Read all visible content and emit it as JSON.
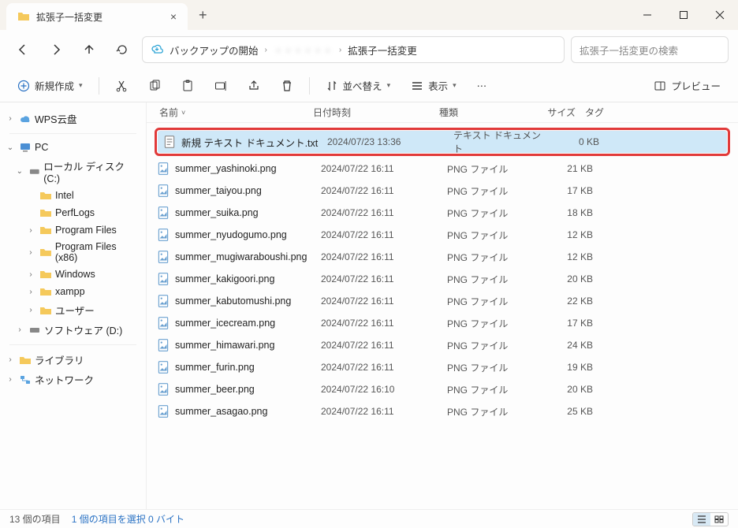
{
  "window": {
    "tab_title": "拡張子一括変更"
  },
  "nav": {
    "address_root": "バックアップの開始",
    "address_mid": "・・・・・・",
    "address_leaf": "拡張子一括変更",
    "search_placeholder": "拡張子一括変更の検索"
  },
  "toolbar": {
    "new_label": "新規作成",
    "sort_label": "並べ替え",
    "view_label": "表示",
    "preview_label": "プレビュー"
  },
  "columns": {
    "name": "名前",
    "date": "日付時刻",
    "type": "種類",
    "size": "サイズ",
    "tag": "タグ"
  },
  "sidebar": {
    "wps": "WPS云盘",
    "pc": "PC",
    "local_disk": "ローカル ディスク (C:)",
    "intel": "Intel",
    "perflogs": "PerfLogs",
    "program_files": "Program Files",
    "program_files_x86": "Program Files (x86)",
    "windows": "Windows",
    "xampp": "xampp",
    "user": "ユーザー",
    "software_d": "ソフトウェア (D:)",
    "library": "ライブラリ",
    "network": "ネットワーク"
  },
  "files": [
    {
      "name": "新規 テキスト ドキュメント.txt",
      "date": "2024/07/23 13:36",
      "type": "テキスト ドキュメント",
      "size": "0 KB",
      "icon": "txt",
      "selected": true
    },
    {
      "name": "summer_yashinoki.png",
      "date": "2024/07/22 16:11",
      "type": "PNG ファイル",
      "size": "21 KB",
      "icon": "png"
    },
    {
      "name": "summer_taiyou.png",
      "date": "2024/07/22 16:11",
      "type": "PNG ファイル",
      "size": "17 KB",
      "icon": "png"
    },
    {
      "name": "summer_suika.png",
      "date": "2024/07/22 16:11",
      "type": "PNG ファイル",
      "size": "18 KB",
      "icon": "png"
    },
    {
      "name": "summer_nyudogumo.png",
      "date": "2024/07/22 16:11",
      "type": "PNG ファイル",
      "size": "12 KB",
      "icon": "png"
    },
    {
      "name": "summer_mugiwaraboushi.png",
      "date": "2024/07/22 16:11",
      "type": "PNG ファイル",
      "size": "12 KB",
      "icon": "png"
    },
    {
      "name": "summer_kakigoori.png",
      "date": "2024/07/22 16:11",
      "type": "PNG ファイル",
      "size": "20 KB",
      "icon": "png"
    },
    {
      "name": "summer_kabutomushi.png",
      "date": "2024/07/22 16:11",
      "type": "PNG ファイル",
      "size": "22 KB",
      "icon": "png"
    },
    {
      "name": "summer_icecream.png",
      "date": "2024/07/22 16:11",
      "type": "PNG ファイル",
      "size": "17 KB",
      "icon": "png"
    },
    {
      "name": "summer_himawari.png",
      "date": "2024/07/22 16:11",
      "type": "PNG ファイル",
      "size": "24 KB",
      "icon": "png"
    },
    {
      "name": "summer_furin.png",
      "date": "2024/07/22 16:11",
      "type": "PNG ファイル",
      "size": "19 KB",
      "icon": "png"
    },
    {
      "name": "summer_beer.png",
      "date": "2024/07/22 16:10",
      "type": "PNG ファイル",
      "size": "20 KB",
      "icon": "png"
    },
    {
      "name": "summer_asagao.png",
      "date": "2024/07/22 16:11",
      "type": "PNG ファイル",
      "size": "25 KB",
      "icon": "png"
    }
  ],
  "status": {
    "count": "13 個の項目",
    "selection": "1 個の項目を選択 0 バイト"
  }
}
